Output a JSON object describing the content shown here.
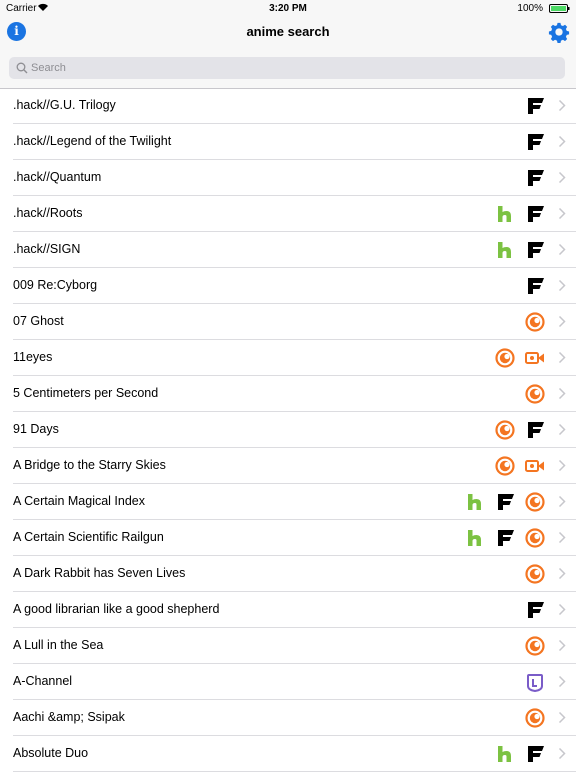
{
  "status": {
    "carrier": "Carrier",
    "time": "3:20 PM",
    "battery": "100%"
  },
  "nav": {
    "title": "anime search",
    "info_icon": "info-icon",
    "settings_icon": "gear-icon"
  },
  "search": {
    "placeholder": "Search",
    "value": ""
  },
  "colors": {
    "accent": "#1a74e2",
    "hulu": "#7cc242",
    "funimation": "#000000",
    "crunchyroll": "#f47521",
    "other": "#7a5cc8"
  },
  "rows": [
    {
      "title": ".hack//G.U. Trilogy",
      "services": [
        "funimation"
      ]
    },
    {
      "title": ".hack//Legend of the Twilight",
      "services": [
        "funimation"
      ]
    },
    {
      "title": ".hack//Quantum",
      "services": [
        "funimation"
      ]
    },
    {
      "title": ".hack//Roots",
      "services": [
        "hulu",
        "funimation"
      ]
    },
    {
      "title": ".hack//SIGN",
      "services": [
        "hulu",
        "funimation"
      ]
    },
    {
      "title": "009 Re:Cyborg",
      "services": [
        "funimation"
      ]
    },
    {
      "title": "07 Ghost",
      "services": [
        "crunchyroll"
      ]
    },
    {
      "title": "11eyes",
      "services": [
        "crunchyroll",
        "video"
      ]
    },
    {
      "title": "5 Centimeters per Second",
      "services": [
        "crunchyroll"
      ]
    },
    {
      "title": "91 Days",
      "services": [
        "crunchyroll",
        "funimation"
      ]
    },
    {
      "title": "A Bridge to the Starry Skies",
      "services": [
        "crunchyroll",
        "video"
      ]
    },
    {
      "title": "A Certain Magical Index",
      "services": [
        "hulu",
        "funimation",
        "crunchyroll"
      ]
    },
    {
      "title": "A Certain Scientific Railgun",
      "services": [
        "hulu",
        "funimation",
        "crunchyroll"
      ]
    },
    {
      "title": "A Dark Rabbit has Seven Lives",
      "services": [
        "crunchyroll"
      ]
    },
    {
      "title": "A good librarian like a good shepherd",
      "services": [
        "funimation"
      ]
    },
    {
      "title": "A Lull in the Sea",
      "services": [
        "crunchyroll"
      ]
    },
    {
      "title": "A-Channel",
      "services": [
        "other"
      ]
    },
    {
      "title": "Aachi &amp; Ssipak",
      "services": [
        "crunchyroll"
      ]
    },
    {
      "title": "Absolute Duo",
      "services": [
        "hulu",
        "funimation"
      ]
    }
  ]
}
